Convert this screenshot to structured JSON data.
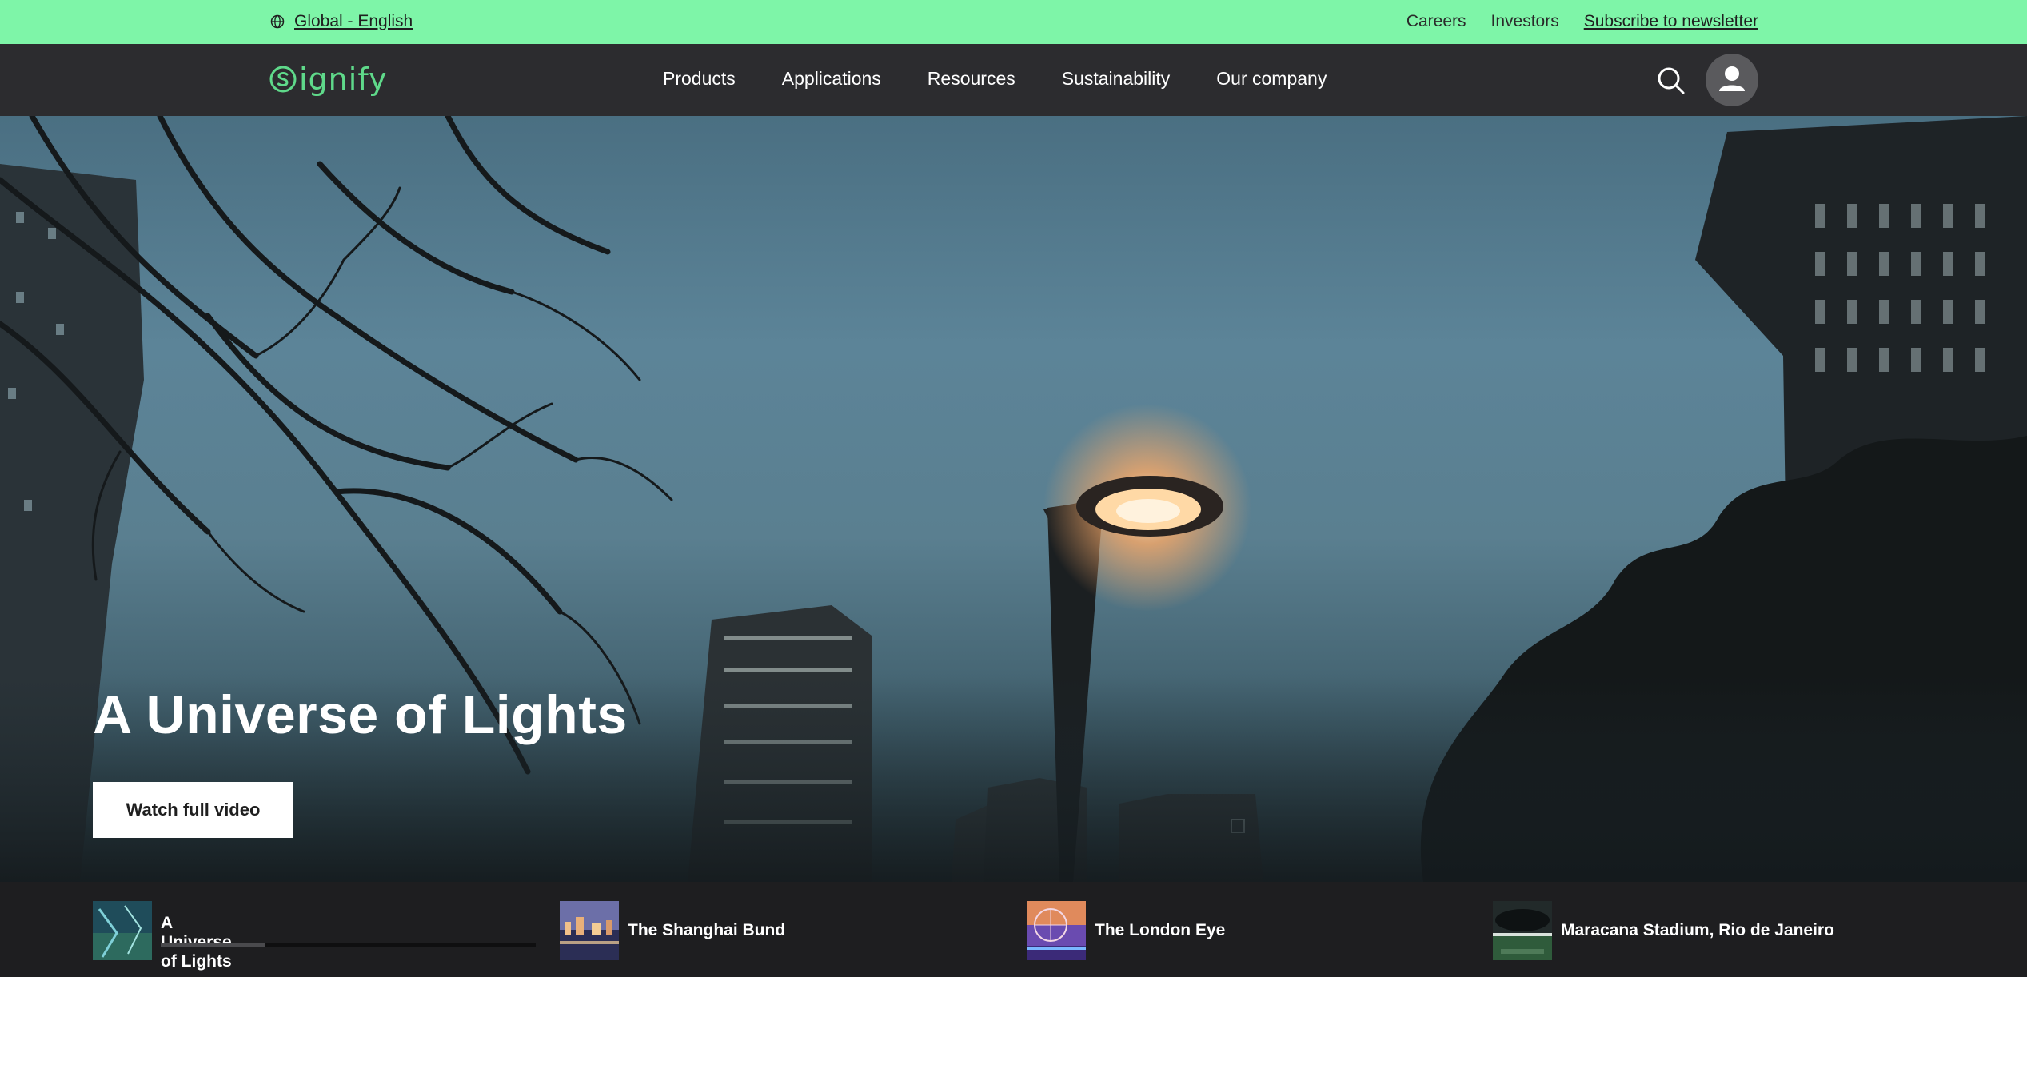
{
  "topbar": {
    "locale": "Global - English",
    "careers": "Careers",
    "investors": "Investors",
    "newsletter": "Subscribe to newsletter"
  },
  "brand": {
    "name": "ignify",
    "accent": "#5fd98a"
  },
  "nav": {
    "items": [
      "Products",
      "Applications",
      "Resources",
      "Sustainability",
      "Our company"
    ]
  },
  "hero": {
    "title": "A Universe of Lights",
    "cta": "Watch full video"
  },
  "videos": [
    {
      "title": "A Universe of Lights",
      "active": true,
      "progress": 0.28
    },
    {
      "title": "The Shanghai Bund"
    },
    {
      "title": "The London Eye"
    },
    {
      "title": "Maracana Stadium, Rio de Janeiro"
    }
  ],
  "colors": {
    "topbar": "#7ef5a8",
    "nav": "#2c2c2f",
    "strip": "#1e1e20"
  }
}
